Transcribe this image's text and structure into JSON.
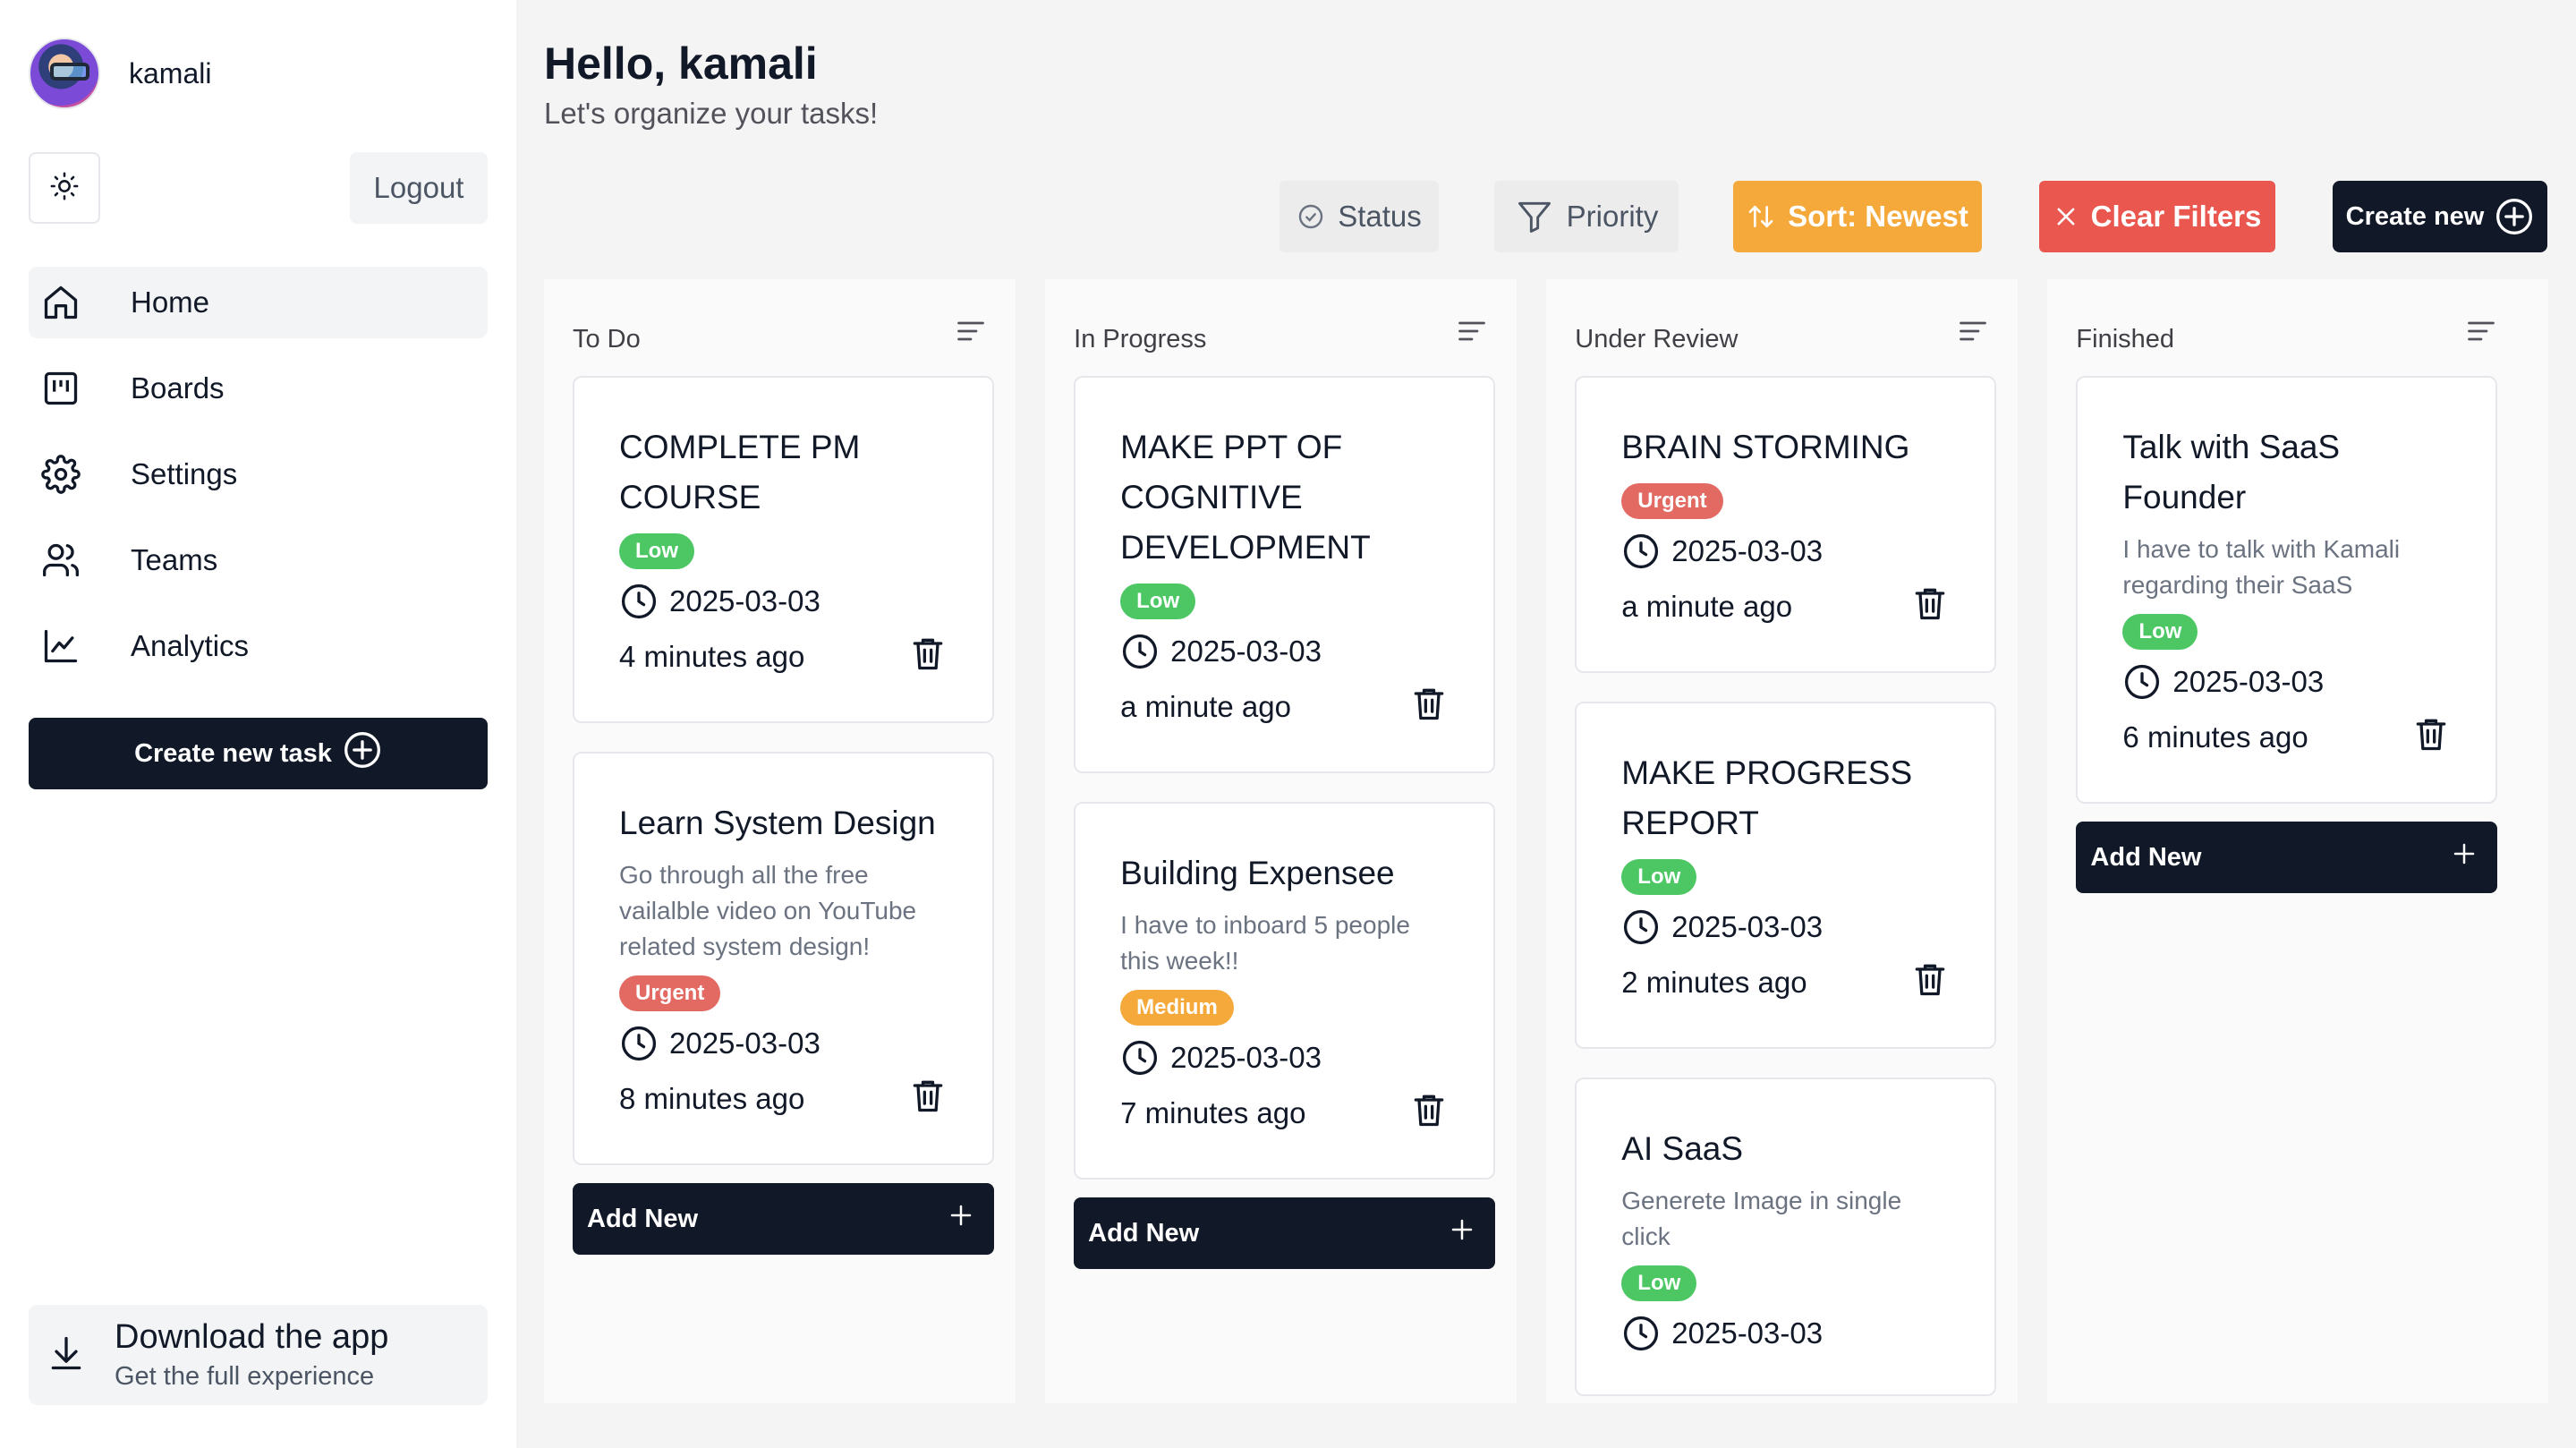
{
  "user": {
    "name": "kamali"
  },
  "sidebar": {
    "logout_label": "Logout",
    "nav": [
      {
        "label": "Home",
        "icon": "home-icon",
        "active": true
      },
      {
        "label": "Boards",
        "icon": "board-icon"
      },
      {
        "label": "Settings",
        "icon": "gear-icon"
      },
      {
        "label": "Teams",
        "icon": "users-icon"
      },
      {
        "label": "Analytics",
        "icon": "chart-icon"
      }
    ],
    "create_task_label": "Create new task",
    "download": {
      "title": "Download the app",
      "subtitle": "Get the full experience"
    }
  },
  "header": {
    "greeting": "Hello, kamali",
    "subtitle": "Let's organize your tasks!"
  },
  "toolbar": {
    "status_label": "Status",
    "priority_label": "Priority",
    "sort_label": "Sort: Newest",
    "clear_label": "Clear Filters",
    "create_label": "Create new"
  },
  "colors": {
    "dark": "#111827",
    "sort": "#f5a93a",
    "clear": "#e9574f",
    "low": "#4cc764",
    "urgent": "#e26a63",
    "medium": "#f5a93a"
  },
  "columns": [
    {
      "title": "To Do",
      "add_label": "Add New",
      "cards": [
        {
          "title": "COMPLETE PM COURSE",
          "priority": "Low",
          "date": "2025-03-03",
          "ago": "4 minutes ago"
        },
        {
          "title": "Learn System Design",
          "desc": "Go through all the free vailalble video on YouTube related system design!",
          "priority": "Urgent",
          "date": "2025-03-03",
          "ago": "8 minutes ago"
        }
      ]
    },
    {
      "title": "In Progress",
      "add_label": "Add New",
      "cards": [
        {
          "title": "MAKE PPT OF COGNITIVE DEVELOPMENT",
          "priority": "Low",
          "date": "2025-03-03",
          "ago": "a minute ago"
        },
        {
          "title": "Building Expensee",
          "desc": "I have to inboard 5 people this week!!",
          "priority": "Medium",
          "date": "2025-03-03",
          "ago": "7 minutes ago"
        }
      ]
    },
    {
      "title": "Under Review",
      "cards": [
        {
          "title": "BRAIN STORMING",
          "priority": "Urgent",
          "date": "2025-03-03",
          "ago": "a minute ago"
        },
        {
          "title": "MAKE PROGRESS REPORT",
          "priority": "Low",
          "date": "2025-03-03",
          "ago": "2 minutes ago"
        },
        {
          "title": "AI SaaS",
          "desc": "Generete Image in single click",
          "priority": "Low",
          "date": "2025-03-03",
          "ago": ""
        }
      ]
    },
    {
      "title": "Finished",
      "add_label": "Add New",
      "cards": [
        {
          "title": "Talk with SaaS Founder",
          "desc": "I have to talk with Kamali regarding their SaaS",
          "priority": "Low",
          "date": "2025-03-03",
          "ago": "6 minutes ago"
        }
      ]
    }
  ]
}
